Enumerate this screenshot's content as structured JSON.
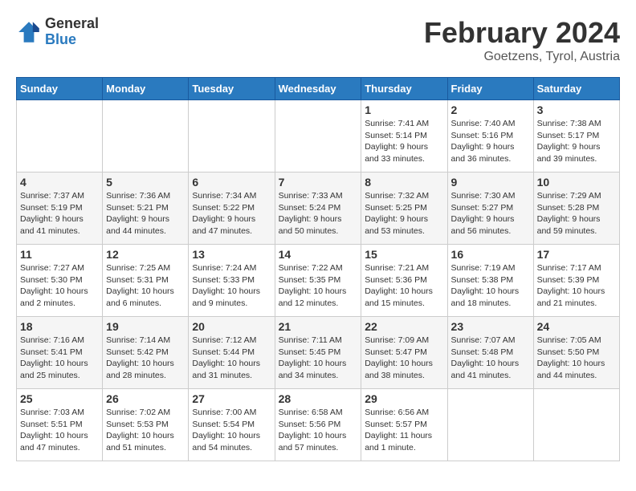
{
  "header": {
    "logo_general": "General",
    "logo_blue": "Blue",
    "month_title": "February 2024",
    "location": "Goetzens, Tyrol, Austria"
  },
  "weekdays": [
    "Sunday",
    "Monday",
    "Tuesday",
    "Wednesday",
    "Thursday",
    "Friday",
    "Saturday"
  ],
  "weeks": [
    [
      {
        "day": "",
        "info": ""
      },
      {
        "day": "",
        "info": ""
      },
      {
        "day": "",
        "info": ""
      },
      {
        "day": "",
        "info": ""
      },
      {
        "day": "1",
        "info": "Sunrise: 7:41 AM\nSunset: 5:14 PM\nDaylight: 9 hours\nand 33 minutes."
      },
      {
        "day": "2",
        "info": "Sunrise: 7:40 AM\nSunset: 5:16 PM\nDaylight: 9 hours\nand 36 minutes."
      },
      {
        "day": "3",
        "info": "Sunrise: 7:38 AM\nSunset: 5:17 PM\nDaylight: 9 hours\nand 39 minutes."
      }
    ],
    [
      {
        "day": "4",
        "info": "Sunrise: 7:37 AM\nSunset: 5:19 PM\nDaylight: 9 hours\nand 41 minutes."
      },
      {
        "day": "5",
        "info": "Sunrise: 7:36 AM\nSunset: 5:21 PM\nDaylight: 9 hours\nand 44 minutes."
      },
      {
        "day": "6",
        "info": "Sunrise: 7:34 AM\nSunset: 5:22 PM\nDaylight: 9 hours\nand 47 minutes."
      },
      {
        "day": "7",
        "info": "Sunrise: 7:33 AM\nSunset: 5:24 PM\nDaylight: 9 hours\nand 50 minutes."
      },
      {
        "day": "8",
        "info": "Sunrise: 7:32 AM\nSunset: 5:25 PM\nDaylight: 9 hours\nand 53 minutes."
      },
      {
        "day": "9",
        "info": "Sunrise: 7:30 AM\nSunset: 5:27 PM\nDaylight: 9 hours\nand 56 minutes."
      },
      {
        "day": "10",
        "info": "Sunrise: 7:29 AM\nSunset: 5:28 PM\nDaylight: 9 hours\nand 59 minutes."
      }
    ],
    [
      {
        "day": "11",
        "info": "Sunrise: 7:27 AM\nSunset: 5:30 PM\nDaylight: 10 hours\nand 2 minutes."
      },
      {
        "day": "12",
        "info": "Sunrise: 7:25 AM\nSunset: 5:31 PM\nDaylight: 10 hours\nand 6 minutes."
      },
      {
        "day": "13",
        "info": "Sunrise: 7:24 AM\nSunset: 5:33 PM\nDaylight: 10 hours\nand 9 minutes."
      },
      {
        "day": "14",
        "info": "Sunrise: 7:22 AM\nSunset: 5:35 PM\nDaylight: 10 hours\nand 12 minutes."
      },
      {
        "day": "15",
        "info": "Sunrise: 7:21 AM\nSunset: 5:36 PM\nDaylight: 10 hours\nand 15 minutes."
      },
      {
        "day": "16",
        "info": "Sunrise: 7:19 AM\nSunset: 5:38 PM\nDaylight: 10 hours\nand 18 minutes."
      },
      {
        "day": "17",
        "info": "Sunrise: 7:17 AM\nSunset: 5:39 PM\nDaylight: 10 hours\nand 21 minutes."
      }
    ],
    [
      {
        "day": "18",
        "info": "Sunrise: 7:16 AM\nSunset: 5:41 PM\nDaylight: 10 hours\nand 25 minutes."
      },
      {
        "day": "19",
        "info": "Sunrise: 7:14 AM\nSunset: 5:42 PM\nDaylight: 10 hours\nand 28 minutes."
      },
      {
        "day": "20",
        "info": "Sunrise: 7:12 AM\nSunset: 5:44 PM\nDaylight: 10 hours\nand 31 minutes."
      },
      {
        "day": "21",
        "info": "Sunrise: 7:11 AM\nSunset: 5:45 PM\nDaylight: 10 hours\nand 34 minutes."
      },
      {
        "day": "22",
        "info": "Sunrise: 7:09 AM\nSunset: 5:47 PM\nDaylight: 10 hours\nand 38 minutes."
      },
      {
        "day": "23",
        "info": "Sunrise: 7:07 AM\nSunset: 5:48 PM\nDaylight: 10 hours\nand 41 minutes."
      },
      {
        "day": "24",
        "info": "Sunrise: 7:05 AM\nSunset: 5:50 PM\nDaylight: 10 hours\nand 44 minutes."
      }
    ],
    [
      {
        "day": "25",
        "info": "Sunrise: 7:03 AM\nSunset: 5:51 PM\nDaylight: 10 hours\nand 47 minutes."
      },
      {
        "day": "26",
        "info": "Sunrise: 7:02 AM\nSunset: 5:53 PM\nDaylight: 10 hours\nand 51 minutes."
      },
      {
        "day": "27",
        "info": "Sunrise: 7:00 AM\nSunset: 5:54 PM\nDaylight: 10 hours\nand 54 minutes."
      },
      {
        "day": "28",
        "info": "Sunrise: 6:58 AM\nSunset: 5:56 PM\nDaylight: 10 hours\nand 57 minutes."
      },
      {
        "day": "29",
        "info": "Sunrise: 6:56 AM\nSunset: 5:57 PM\nDaylight: 11 hours\nand 1 minute."
      },
      {
        "day": "",
        "info": ""
      },
      {
        "day": "",
        "info": ""
      }
    ]
  ]
}
